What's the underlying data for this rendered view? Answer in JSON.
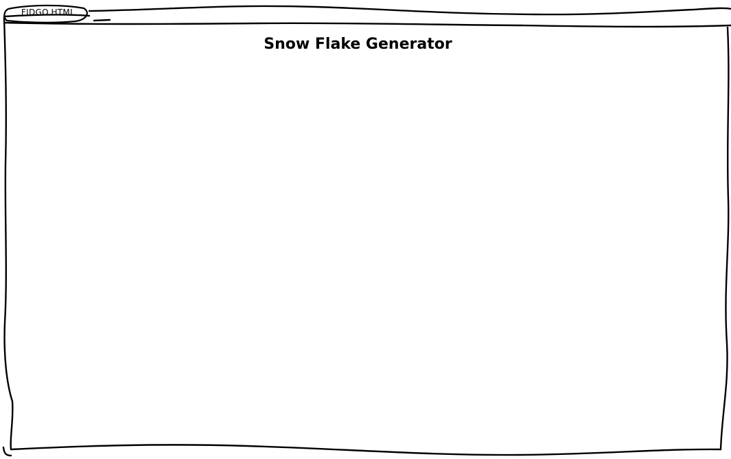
{
  "tab": {
    "label": "FIDGO.HTML"
  },
  "page": {
    "title": "Snow Flake Generator"
  },
  "colors": {
    "ink": "#000000",
    "background": "#ffffff"
  }
}
